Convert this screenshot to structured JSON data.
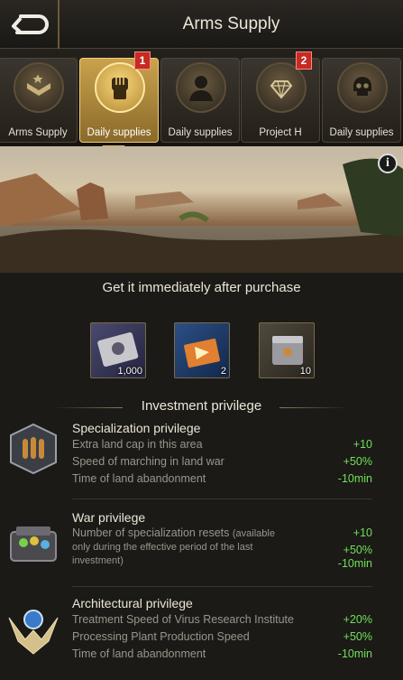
{
  "header": {
    "title": "Arms Supply"
  },
  "tabs": [
    {
      "label": "Arms Supply",
      "icon": "rank-chevron-icon",
      "badge": null,
      "active": false
    },
    {
      "label": "Daily supplies",
      "icon": "fist-icon",
      "badge": "1",
      "active": true
    },
    {
      "label": "Daily supplies",
      "icon": "soldier-silhouette-icon",
      "badge": null,
      "active": false
    },
    {
      "label": "Project H",
      "icon": "diamond-laurel-icon",
      "badge": "2",
      "active": false
    },
    {
      "label": "Daily supplies",
      "icon": "skull-icon",
      "badge": null,
      "active": false
    }
  ],
  "subtitle": "Get it immediately after purchase",
  "rewards": [
    {
      "icon": "cash-crate-icon",
      "qty": "1,000"
    },
    {
      "icon": "ticket-card-icon",
      "qty": "2"
    },
    {
      "icon": "resource-box-icon",
      "qty": "10"
    }
  ],
  "section_title": "Investment privilege",
  "privileges": [
    {
      "name": "Specialization privilege",
      "icon": "ammo-badge-icon",
      "rows": [
        {
          "label": "Extra land cap in this area",
          "value": "+10"
        },
        {
          "label": "Speed of marching in land war",
          "value": "+50%"
        },
        {
          "label": "Time of land abandonment",
          "value": "-10min"
        }
      ]
    },
    {
      "name": "War privilege",
      "icon": "supply-crate-icon",
      "rows": [
        {
          "label": "Number of specialization resets",
          "note": "(available only during the effective period of the last investment)",
          "value": "+10"
        },
        {
          "label": "",
          "value": "+50%"
        },
        {
          "label": "",
          "value": "-10min"
        }
      ]
    },
    {
      "name": "Architectural privilege",
      "icon": "winged-globe-icon",
      "rows": [
        {
          "label": "Treatment Speed of Virus Research Institute",
          "value": "+20%"
        },
        {
          "label": "Processing Plant Production Speed",
          "value": "+50%"
        },
        {
          "label": "Time of land abandonment",
          "value": "-10min"
        }
      ]
    }
  ]
}
